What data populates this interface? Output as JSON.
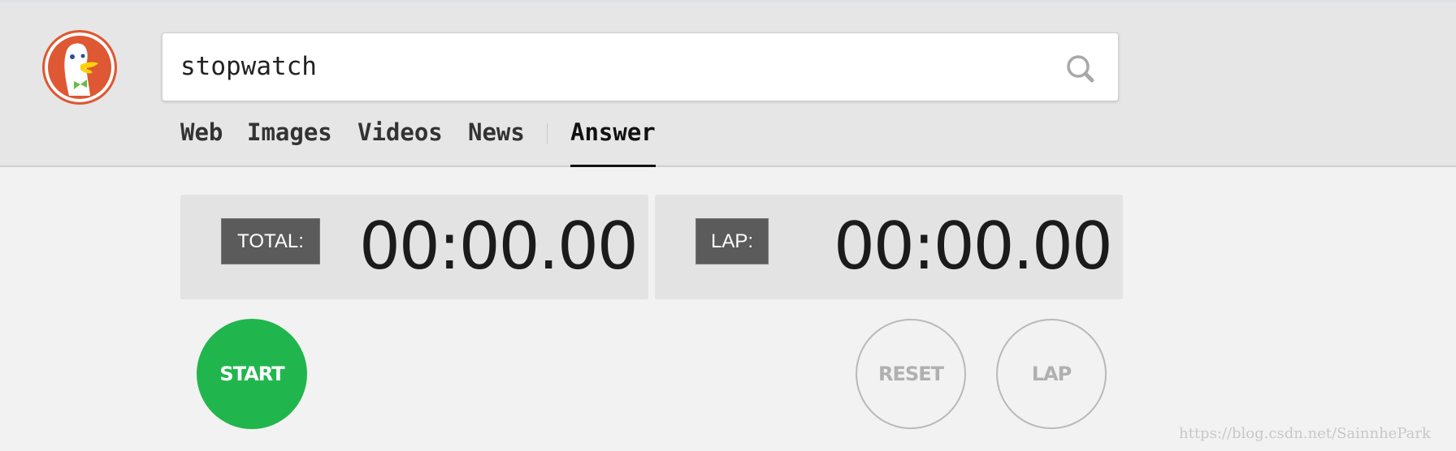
{
  "search": {
    "value": "stopwatch",
    "icon": "search-icon"
  },
  "tabs": [
    {
      "label": "Web",
      "active": false
    },
    {
      "label": "Images",
      "active": false
    },
    {
      "label": "Videos",
      "active": false
    },
    {
      "label": "News",
      "active": false
    },
    {
      "label": "Answer",
      "active": true
    }
  ],
  "stopwatch": {
    "total_label": "TOTAL:",
    "total_time": "00:00.00",
    "lap_label": "LAP:",
    "lap_time": "00:00.00",
    "start_label": "START",
    "reset_label": "RESET",
    "lap_button_label": "LAP"
  },
  "colors": {
    "brand": "#de5833",
    "start": "#21b64d"
  },
  "watermark": "https://blog.csdn.net/SainnhePark"
}
